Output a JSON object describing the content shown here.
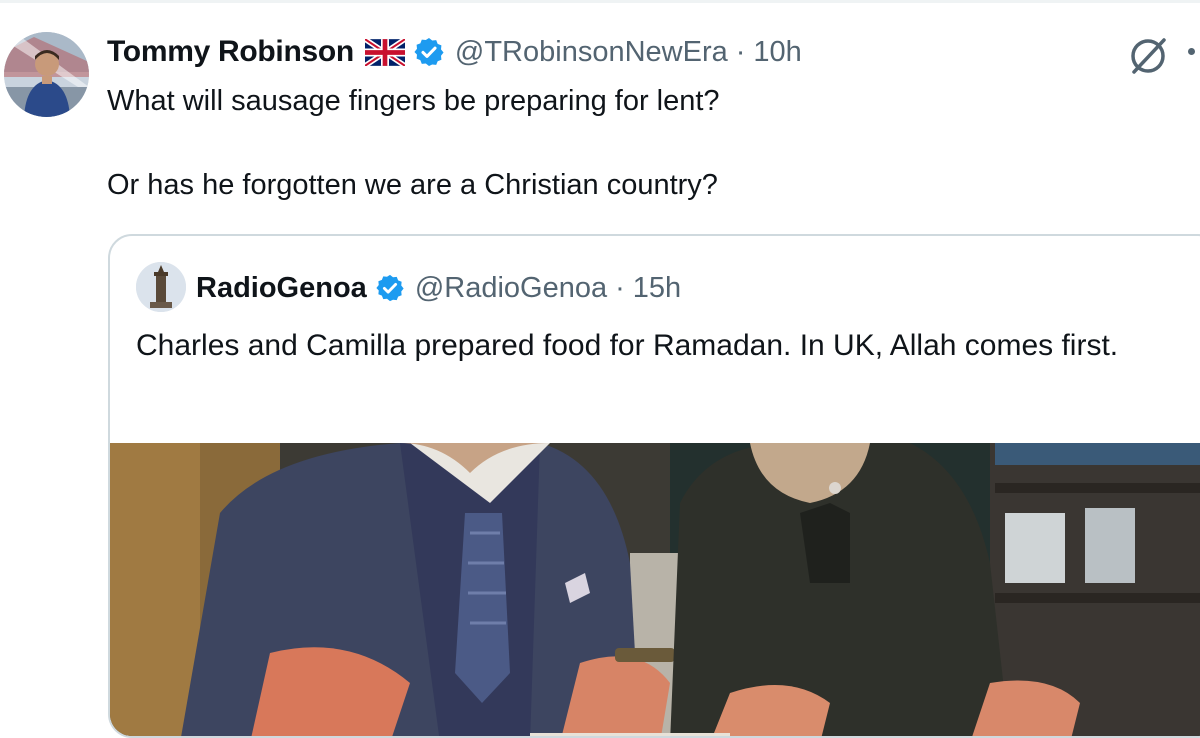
{
  "tweet": {
    "author_name": "Tommy Robinson",
    "flag_icon": "uk-flag-icon",
    "verified_icon": "verified-badge-icon",
    "handle": "@TRobinsonNewEra",
    "separator": "·",
    "time": "10h",
    "text_line_1": "What will sausage fingers be preparing for lent?",
    "text_line_2": "Or has he forgotten we are a Christian country?",
    "grok_icon": "grok-icon",
    "more_icon": "more-icon"
  },
  "quote": {
    "author_name": "RadioGenoa",
    "verified_icon": "verified-badge-icon",
    "handle": "@RadioGenoa",
    "separator": "·",
    "time": "15h",
    "text": "Charles and Camilla prepared food for Ramadan. In UK, Allah comes first."
  },
  "colors": {
    "text": "#0f1419",
    "secondary": "#536471",
    "verified_blue": "#1d9bf0",
    "border": "#cfd9de"
  }
}
